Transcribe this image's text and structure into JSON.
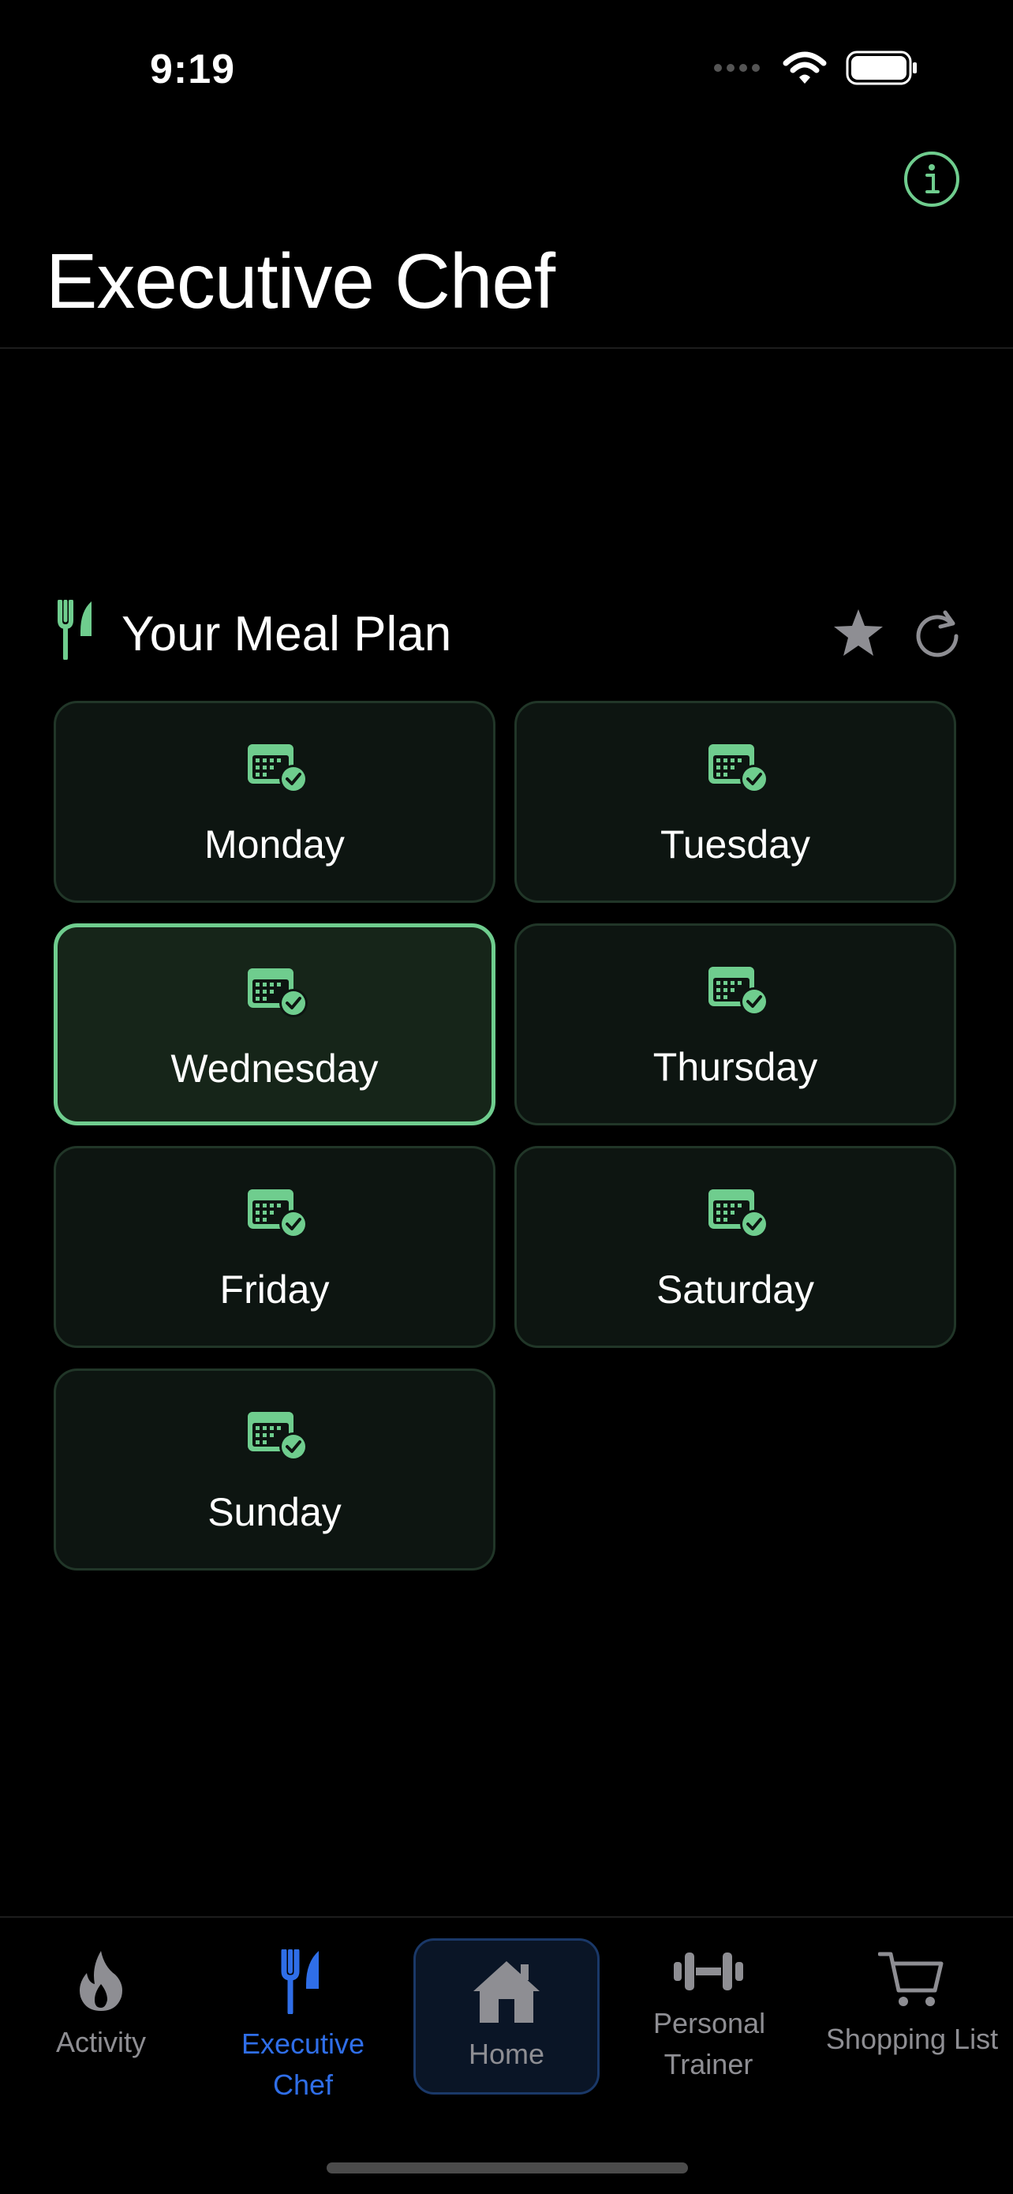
{
  "status_bar": {
    "time": "9:19"
  },
  "header": {
    "title": "Executive Chef"
  },
  "meal_plan": {
    "title": "Your Meal Plan",
    "days": [
      {
        "label": "Monday",
        "selected": false
      },
      {
        "label": "Tuesday",
        "selected": false
      },
      {
        "label": "Wednesday",
        "selected": true
      },
      {
        "label": "Thursday",
        "selected": false
      },
      {
        "label": "Friday",
        "selected": false
      },
      {
        "label": "Saturday",
        "selected": false
      },
      {
        "label": "Sunday",
        "selected": false
      }
    ]
  },
  "tab_bar": {
    "items": [
      {
        "label": "Activity",
        "icon": "flame-icon"
      },
      {
        "label": "Executive Chef",
        "icon": "fork-knife-icon",
        "active": true
      },
      {
        "label": "Home",
        "icon": "home-icon"
      },
      {
        "label": "Personal Trainer",
        "icon": "dumbbell-icon"
      },
      {
        "label": "Shopping List",
        "icon": "cart-icon"
      }
    ]
  },
  "colors": {
    "accent_green": "#6fcd8e",
    "active_tab_blue": "#2f6ee8",
    "inactive_gray": "#8e8e93"
  }
}
